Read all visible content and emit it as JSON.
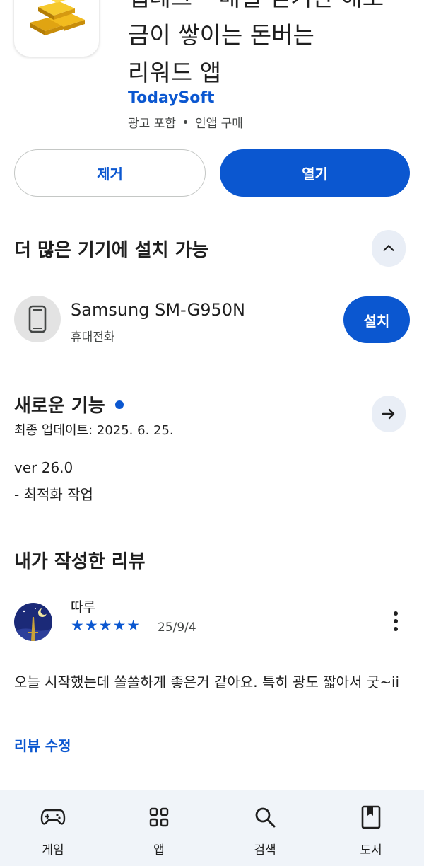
{
  "header": {
    "app_icon": "gold-bars-icon",
    "title_lines": [
      "앱테크 – 매일 걷기만 해도",
      "금이 쌓이는 돈버는",
      "리워드 앱"
    ],
    "developer": "TodaySoft",
    "meta_ads": "광고 포함",
    "meta_iap": "인앱 구매"
  },
  "actions": {
    "uninstall_label": "제거",
    "open_label": "열기"
  },
  "more_devices": {
    "title": "더 많은 기기에 설치 가능",
    "device_name": "Samsung SM-G950N",
    "device_type": "휴대전화",
    "install_label": "설치"
  },
  "whats_new": {
    "title": "새로운 기능",
    "last_updated": "최종 업데이트: 2025. 6. 25.",
    "version": "ver 26.0",
    "note": "- 최적화 작업"
  },
  "my_review": {
    "title": "내가 작성한 리뷰",
    "reviewer": "따루",
    "rating": 5,
    "stars": "★★★★★",
    "date": "25/9/4",
    "text": "오늘 시작했는데 쏠쏠하게 좋은거 같아요. 특히 광도 짧아서 굿~ii",
    "edit_label": "리뷰 수정"
  },
  "bottom_nav": {
    "games": "게임",
    "apps": "앱",
    "search": "검색",
    "books": "도서"
  },
  "colors": {
    "accent": "#0b57d0",
    "nav_bg": "#f0f4f9",
    "chip_bg": "#e9eef6"
  }
}
